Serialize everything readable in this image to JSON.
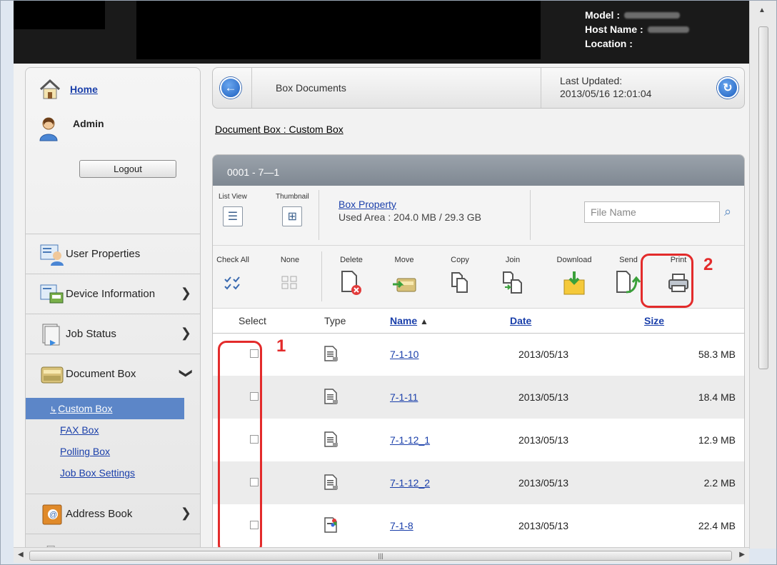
{
  "header": {
    "model_label": "Model :",
    "host_label": "Host Name :",
    "location_label": "Location :"
  },
  "sidebar": {
    "home": "Home",
    "user": "Admin",
    "logout": "Logout",
    "items": [
      {
        "label": "User Properties",
        "icon": "user-properties-icon"
      },
      {
        "label": "Device Information",
        "icon": "device-information-icon"
      },
      {
        "label": "Job Status",
        "icon": "job-status-icon"
      },
      {
        "label": "Document Box",
        "icon": "document-box-icon"
      }
    ],
    "sub_items": [
      "Custom Box",
      "FAX Box",
      "Polling Box",
      "Job Box Settings"
    ],
    "address_book": "Address Book"
  },
  "topbar": {
    "title": "Box Documents",
    "last_updated_label": "Last Updated:",
    "last_updated_value": "2013/05/16 12:01:04"
  },
  "breadcrumb": "Document Box : Custom Box",
  "panel": {
    "title": "0001 - 7—1",
    "list_view": "List View",
    "thumbnail": "Thumbnail",
    "box_property": "Box Property",
    "used_area": "Used Area : 204.0 MB / 29.3 GB",
    "file_name_placeholder": "File Name"
  },
  "toolbar": {
    "check_all": "Check All",
    "none": "None",
    "delete": "Delete",
    "move": "Move",
    "copy": "Copy",
    "join": "Join",
    "download": "Download",
    "send": "Send",
    "print": "Print"
  },
  "table": {
    "headers": {
      "select": "Select",
      "type": "Type",
      "name": "Name",
      "sort_indicator": "▲",
      "date": "Date",
      "size": "Size"
    },
    "rows": [
      {
        "name": "7-1-10",
        "date": "2013/05/13",
        "size": "58.3 MB"
      },
      {
        "name": "7-1-11",
        "date": "2013/05/13",
        "size": "18.4 MB"
      },
      {
        "name": "7-1-12_1",
        "date": "2013/05/13",
        "size": "12.9 MB"
      },
      {
        "name": "7-1-12_2",
        "date": "2013/05/13",
        "size": "2.2 MB"
      },
      {
        "name": "7-1-8",
        "date": "2013/05/13",
        "size": "22.4 MB"
      }
    ]
  },
  "annotations": {
    "one": "1",
    "two": "2"
  },
  "colors": {
    "accent_red": "#e32b2b",
    "link_blue": "#1a3faa",
    "active_blue": "#5c86c8"
  }
}
